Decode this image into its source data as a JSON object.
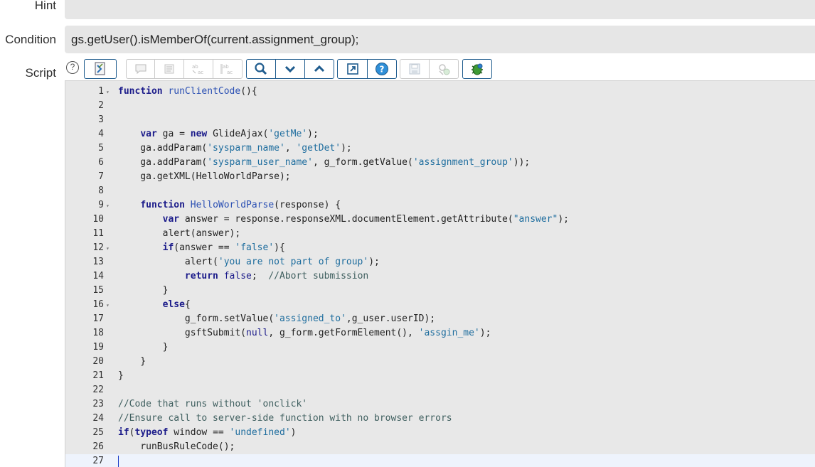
{
  "form": {
    "hint": {
      "label": "Hint",
      "value": ""
    },
    "condition": {
      "label": "Condition",
      "value": "gs.getUser().isMemberOf(current.assignment_group);"
    },
    "script": {
      "label": "Script"
    }
  },
  "toolbar": {
    "help_glyph": "?",
    "buttons": [
      "toggle-syntax-editor-icon",
      "comment-icon",
      "format-code-icon",
      "replace-icon",
      "replace-all-icon",
      "search-icon",
      "chevron-down-icon",
      "chevron-up-icon",
      "fullscreen-icon",
      "help-circle-icon",
      "save-icon",
      "script-debugger-icon",
      "debug-bug-icon"
    ]
  },
  "editor": {
    "lines": [
      {
        "n": "1",
        "fold": true,
        "code": "function runClientCode(){"
      },
      {
        "n": "2",
        "fold": false,
        "code": ""
      },
      {
        "n": "3",
        "fold": false,
        "code": ""
      },
      {
        "n": "4",
        "fold": false,
        "code": "    var ga = new GlideAjax('getMe');"
      },
      {
        "n": "5",
        "fold": false,
        "code": "    ga.addParam('sysparm_name', 'getDet');"
      },
      {
        "n": "6",
        "fold": false,
        "code": "    ga.addParam('sysparm_user_name', g_form.getValue('assignment_group'));"
      },
      {
        "n": "7",
        "fold": false,
        "code": "    ga.getXML(HelloWorldParse);"
      },
      {
        "n": "8",
        "fold": false,
        "code": ""
      },
      {
        "n": "9",
        "fold": true,
        "code": "    function HelloWorldParse(response) {"
      },
      {
        "n": "10",
        "fold": false,
        "code": "        var answer = response.responseXML.documentElement.getAttribute(\"answer\");"
      },
      {
        "n": "11",
        "fold": false,
        "code": "        alert(answer);"
      },
      {
        "n": "12",
        "fold": true,
        "code": "        if(answer == 'false'){"
      },
      {
        "n": "13",
        "fold": false,
        "code": "            alert('you are not part of group');"
      },
      {
        "n": "14",
        "fold": false,
        "code": "            return false;  //Abort submission"
      },
      {
        "n": "15",
        "fold": false,
        "code": "        }"
      },
      {
        "n": "16",
        "fold": true,
        "code": "        else{"
      },
      {
        "n": "17",
        "fold": false,
        "code": "            g_form.setValue('assigned_to',g_user.userID);"
      },
      {
        "n": "18",
        "fold": false,
        "code": "            gsftSubmit(null, g_form.getFormElement(), 'assgin_me');"
      },
      {
        "n": "19",
        "fold": false,
        "code": "        }"
      },
      {
        "n": "20",
        "fold": false,
        "code": "    }"
      },
      {
        "n": "21",
        "fold": false,
        "code": "}"
      },
      {
        "n": "22",
        "fold": false,
        "code": ""
      },
      {
        "n": "23",
        "fold": false,
        "code": "//Code that runs without 'onclick'"
      },
      {
        "n": "24",
        "fold": false,
        "code": "//Ensure call to server-side function with no browser errors"
      },
      {
        "n": "25",
        "fold": false,
        "code": "if(typeof window == 'undefined')"
      },
      {
        "n": "26",
        "fold": false,
        "code": "    runBusRuleCode();"
      },
      {
        "n": "27",
        "fold": false,
        "code": ""
      }
    ],
    "active_line": 27
  }
}
